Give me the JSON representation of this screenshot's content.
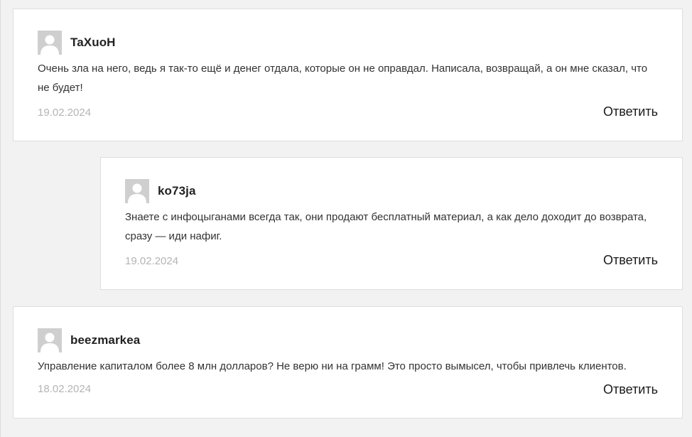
{
  "comments": [
    {
      "author": "TaXuoH",
      "text": "Очень зла на него, ведь я так-то ещё и денег отдала, которые он не оправдал. Написала, возвращай, а он мне сказал, что не будет!",
      "date": "19.02.2024",
      "reply_label": "Ответить",
      "is_reply": false
    },
    {
      "author": "ko73ja",
      "text": "Знаете с инфоцыганами всегда так, они продают бесплатный материал, а как дело доходит до возврата, сразу — иди нафиг.",
      "date": "19.02.2024",
      "reply_label": "Ответить",
      "is_reply": true
    },
    {
      "author": "beezmarkea",
      "text": "Управление капиталом более 8 млн долларов? Не верю ни на грамм! Это просто вымысел, чтобы привлечь клиентов.",
      "date": "18.02.2024",
      "reply_label": "Ответить",
      "is_reply": false
    }
  ],
  "icons": {
    "avatar": "default-user-avatar-icon"
  },
  "colors": {
    "page_background": "#f2f2f2",
    "card_background": "#ffffff",
    "card_border": "#dedede",
    "date_text": "#b4b4b4",
    "avatar_background": "#cfcfcf"
  }
}
